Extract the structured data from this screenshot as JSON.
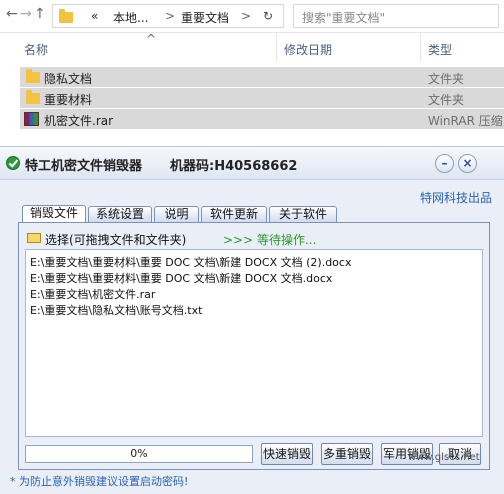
{
  "explorer": {
    "nav_back": "←",
    "nav_forward": "→",
    "nav_up": "↑",
    "breadcrumb": [
      "«",
      "本地...",
      ">",
      "重要文档",
      ">"
    ],
    "refresh": "↻",
    "search_placeholder": "搜索\"重要文档\"",
    "columns": {
      "name": "名称",
      "date": "修改日期",
      "type": "类型"
    },
    "sort_arrow": "^",
    "files": [
      {
        "name": "隐私文档",
        "type": "文件夹",
        "icon": "folder-icon"
      },
      {
        "name": "重要材料",
        "type": "文件夹",
        "icon": "folder-icon"
      },
      {
        "name": "机密文件.rar",
        "type": "WinRAR 压缩",
        "icon": "winrar-icon"
      }
    ]
  },
  "app": {
    "title": "特工机密文件销毁器",
    "machine_code": "机器码:H40568662",
    "minimize": "–",
    "close": "×",
    "brand": "特网科技出品",
    "tabs": [
      "销毁文件",
      "系统设置",
      "说明",
      "软件更新",
      "关于软件"
    ],
    "select_label": "选择(可拖拽文件和文件夹)",
    "status": ">>> 等待操作...",
    "file_list": [
      "E:\\重要文档\\重要材料\\重要 DOC 文档\\新建 DOCX 文档 (2).docx",
      "E:\\重要文档\\重要材料\\重要 DOC 文档\\新建 DOCX 文档.docx",
      "E:\\重要文档\\机密文件.rar",
      "E:\\重要文档\\隐私文档\\账号文档.txt"
    ],
    "progress": 0,
    "progress_text": "0%",
    "buttons": {
      "quick": "快速销毁",
      "multi": "多重销毁",
      "military": "军用销毁",
      "cancel": "取消"
    },
    "footer": "* 为防止意外销毁建议设置启动密码!"
  },
  "watermark": "www.glscc.net"
}
